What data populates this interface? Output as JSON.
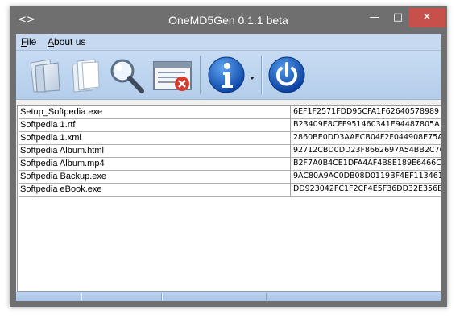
{
  "window": {
    "title": "OneMD5Gen 0.1.1 beta",
    "controls": {
      "minimize": "—",
      "maximize": "□",
      "close": "✕"
    },
    "app_icon": "code-brackets-icon"
  },
  "menu": {
    "file_key": "F",
    "file_rest": "ile",
    "about_key": "A",
    "about_rest": "bout us"
  },
  "toolbar": {
    "buttons": [
      {
        "icon": "open-folder-icon"
      },
      {
        "icon": "documents-icon"
      },
      {
        "icon": "magnifier-search-icon"
      },
      {
        "icon": "clear-list-icon"
      },
      {
        "icon": "info-icon",
        "dropdown": true
      },
      {
        "icon": "power-exit-icon"
      }
    ]
  },
  "files": [
    {
      "name": "Setup_Softpedia.exe",
      "hash": "6EF1F2571FDD95CFA1F62640578989"
    },
    {
      "name": "Softpedia 1.rtf",
      "hash": "B23409E8CFF951460341E94487805A"
    },
    {
      "name": "Softpedia 1.xml",
      "hash": "2860BE0DD3AAECB04F2F044908E75A"
    },
    {
      "name": "Softpedia Album.html",
      "hash": "92712CBD0DD23F8662697A54BB2C7C"
    },
    {
      "name": "Softpedia Album.mp4",
      "hash": "B2F7A0B4CE1DFA4AF4B8E189E6466C"
    },
    {
      "name": "Softpedia Backup.exe",
      "hash": "9AC80A9AC0DB08D0119BF4EF113461"
    },
    {
      "name": "Softpedia eBook.exe",
      "hash": "DD923042FC1F2CF4E5F36DD32E356B"
    }
  ],
  "colors": {
    "titlebar": "#6f6f6f",
    "close": "#c7504b",
    "toolbar": "#b4cdea",
    "info_blue": "#1b63c6"
  }
}
